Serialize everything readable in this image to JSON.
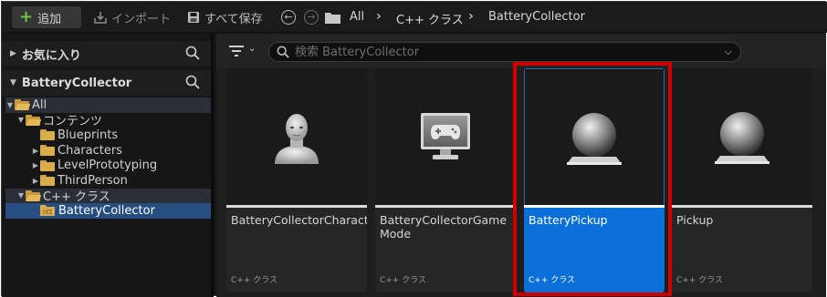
{
  "toolbar": {
    "add_label": "追加",
    "import_label": "インポート",
    "save_all_label": "すべて保存"
  },
  "breadcrumb": [
    "All",
    "C++ クラス",
    "BatteryCollector"
  ],
  "sidebar": {
    "favorites_label": "お気に入り",
    "project_label": "BatteryCollector",
    "tree": [
      {
        "label": "All"
      },
      {
        "label": "コンテンツ"
      },
      {
        "label": "Blueprints"
      },
      {
        "label": "Characters"
      },
      {
        "label": "LevelPrototyping"
      },
      {
        "label": "ThirdPerson"
      },
      {
        "label": "C++ クラス"
      },
      {
        "label": "BatteryCollector"
      }
    ]
  },
  "search": {
    "placeholder": "検索 BatteryCollector"
  },
  "assets": [
    {
      "name": "BatteryCollectorCharacter",
      "type": "C++ クラス",
      "icon": "character-bust-icon"
    },
    {
      "name": "BatteryCollectorGame Mode",
      "type": "C++ クラス",
      "icon": "game-mode-monitor-icon"
    },
    {
      "name": "BatteryPickup",
      "type": "C++ クラス",
      "icon": "actor-sphere-icon"
    },
    {
      "name": "Pickup",
      "type": "C++ クラス",
      "icon": "actor-sphere-icon"
    }
  ],
  "colors": {
    "selection": "#0a6fd8",
    "highlight": "#d00000",
    "add_plus": "#6fc34a",
    "folder": "#d9ac4c"
  }
}
